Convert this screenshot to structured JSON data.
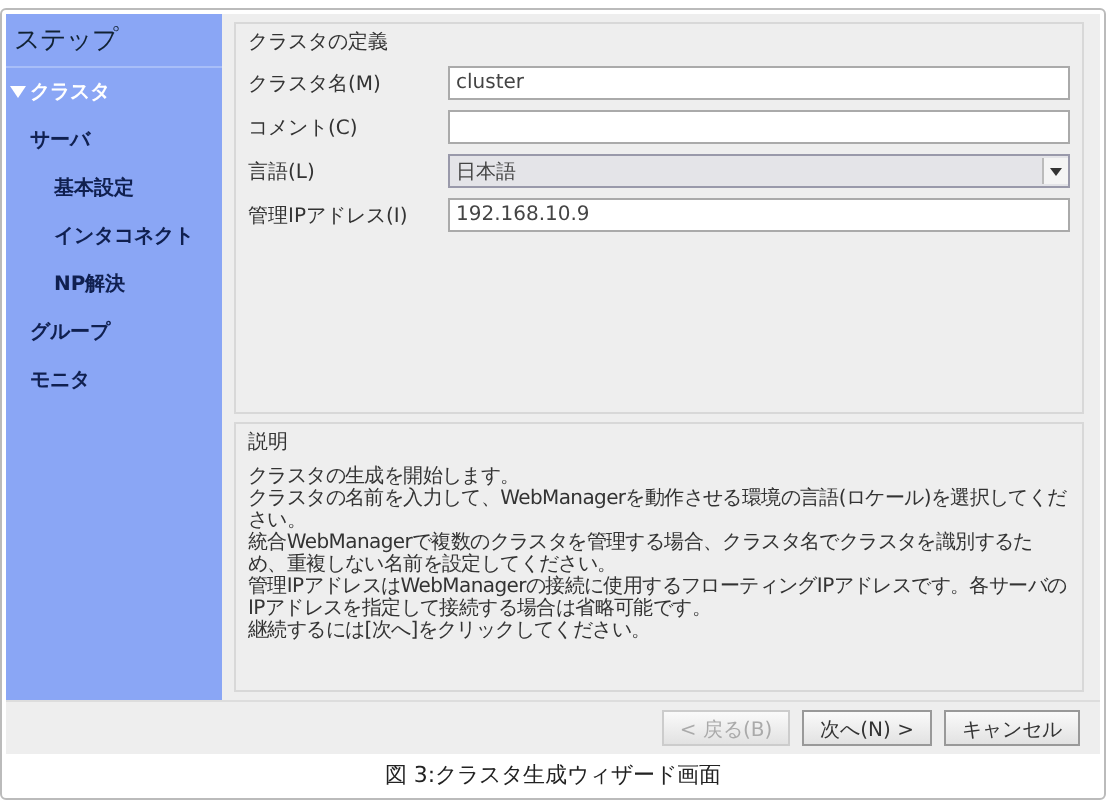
{
  "sidebar": {
    "title": "ステップ",
    "steps": [
      {
        "label": "クラスタ",
        "selected": true
      },
      {
        "label": "サーバ",
        "selected": false,
        "children": [
          {
            "label": "基本設定",
            "selected": false
          },
          {
            "label": "インタコネクト",
            "selected": false
          },
          {
            "label": "NP解決",
            "selected": false
          }
        ]
      },
      {
        "label": "グループ",
        "selected": false
      },
      {
        "label": "モニタ",
        "selected": false
      }
    ]
  },
  "definition": {
    "title": "クラスタの定義",
    "fields": [
      {
        "kind": "text",
        "label": "クラスタ名(M)",
        "value": "cluster"
      },
      {
        "kind": "text",
        "label": "コメント(C)"
      },
      {
        "kind": "select",
        "label": "言語(L)",
        "value": "日本語"
      },
      {
        "kind": "text",
        "label": "管理IPアドレス(I)",
        "value": "192.168.10.9"
      }
    ]
  },
  "description": {
    "title": "説明",
    "lines": [
      "クラスタの生成を開始します。",
      "クラスタの名前を入力して、WebManagerを動作させる環境の言語(ロケール)を選択してください。",
      "統合WebManagerで複数のクラスタを管理する場合、クラスタ名でクラスタを識別するため、重複しない名前を設定してください。",
      "管理IPアドレスはWebManagerの接続に使用するフローティングIPアドレスです。各サーバのIPアドレスを指定して接続する場合は省略可能です。",
      "継続するには[次へ]をクリックしてください。"
    ]
  },
  "buttons": [
    {
      "label": "< 戻る(B)",
      "disabled": true
    },
    {
      "label": "次へ(N) >",
      "disabled": false
    },
    {
      "label": "キャンセル",
      "disabled": false
    }
  ],
  "caption": "図 3:クラスタ生成ウィザード画面"
}
